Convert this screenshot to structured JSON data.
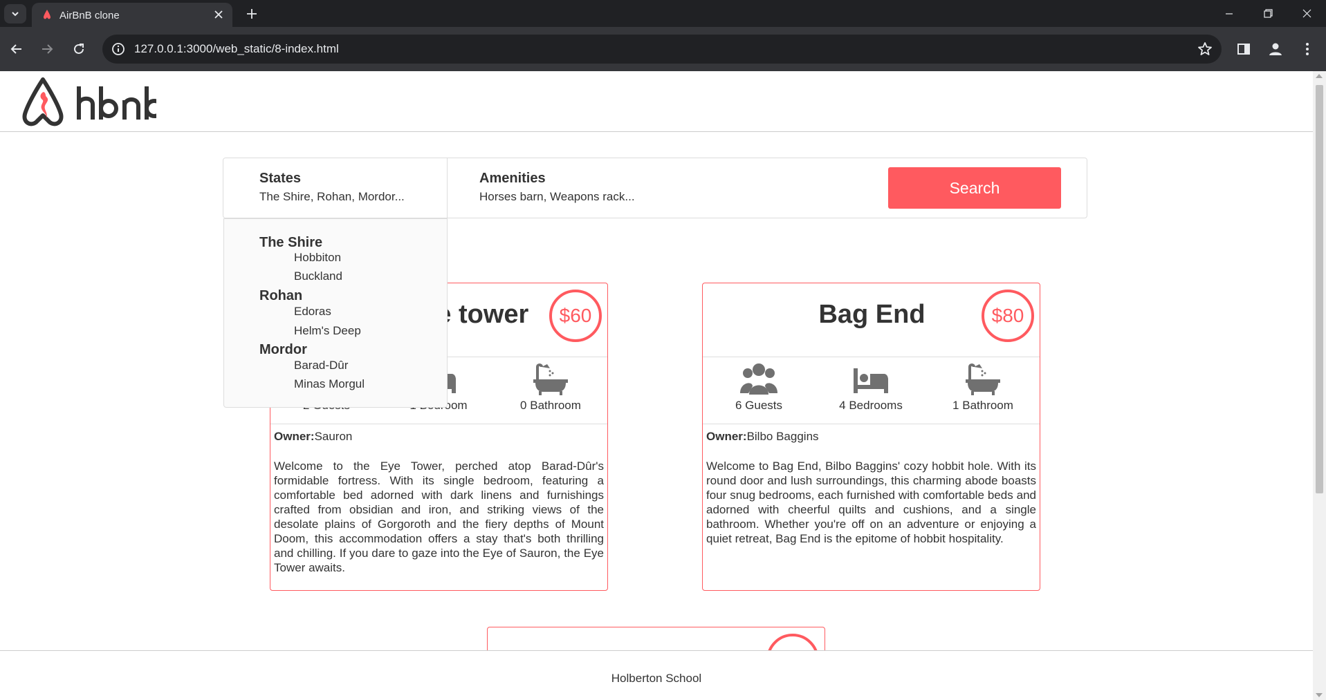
{
  "browser": {
    "tab_title": "AirBnB clone",
    "url": "127.0.0.1:3000/web_static/8-index.html"
  },
  "header": {
    "logo_text": "hbnb"
  },
  "filters": {
    "states": {
      "title": "States",
      "value": "The Shire, Rohan, Mordor..."
    },
    "amenities": {
      "title": "Amenities",
      "value": "Horses barn, Weapons rack..."
    },
    "search_label": "Search"
  },
  "states_popover": [
    {
      "name": "The Shire",
      "cities": [
        "Hobbiton",
        "Buckland"
      ]
    },
    {
      "name": "Rohan",
      "cities": [
        "Edoras",
        "Helm's Deep"
      ]
    },
    {
      "name": "Mordor",
      "cities": [
        "Barad-Dûr",
        "Minas Morgul"
      ]
    }
  ],
  "places": [
    {
      "title": "The Eye tower",
      "price": "$60",
      "guests": "2 Guests",
      "bedrooms": "1 Bedroom",
      "bathrooms": "0 Bathroom",
      "owner_label": "Owner:",
      "owner": "Sauron",
      "description": "Welcome to the Eye Tower, perched atop Barad-Dûr's formidable fortress. With its single bedroom, featuring a comfortable bed adorned with dark linens and furnishings crafted from obsidian and iron, and striking views of the desolate plains of Gorgoroth and the fiery depths of Mount Doom, this accommodation offers a stay that's both thrilling and chilling. If you dare to gaze into the Eye of Sauron, the Eye Tower awaits."
    },
    {
      "title": "Bag End",
      "price": "$80",
      "guests": "6 Guests",
      "bedrooms": "4 Bedrooms",
      "bathrooms": "1 Bathroom",
      "owner_label": "Owner:",
      "owner": "Bilbo Baggins",
      "description": "Welcome to Bag End, Bilbo Baggins' cozy hobbit hole. With its round door and lush surroundings, this charming abode boasts four snug bedrooms, each furnished with comfortable beds and adorned with cheerful quilts and cushions, and a single bathroom. Whether you're off on an adventure or enjoying a quiet retreat, Bag End is the epitome of hobbit hospitality."
    }
  ],
  "footer": {
    "text": "Holberton School"
  },
  "colors": {
    "accent": "#ff5a5f",
    "text": "#333333",
    "border": "#dddddd",
    "chrome_dark": "#202124",
    "chrome_mid": "#35363a"
  },
  "icons": [
    "tab-list-icon",
    "airbnb-favicon-icon",
    "close-icon",
    "plus-icon",
    "minimize-icon",
    "restore-icon",
    "window-close-icon",
    "back-arrow-icon",
    "forward-arrow-icon",
    "reload-icon",
    "site-info-icon",
    "star-icon",
    "side-panel-icon",
    "profile-icon",
    "kebab-menu-icon",
    "guests-icon",
    "bed-icon",
    "bathtub-icon"
  ]
}
